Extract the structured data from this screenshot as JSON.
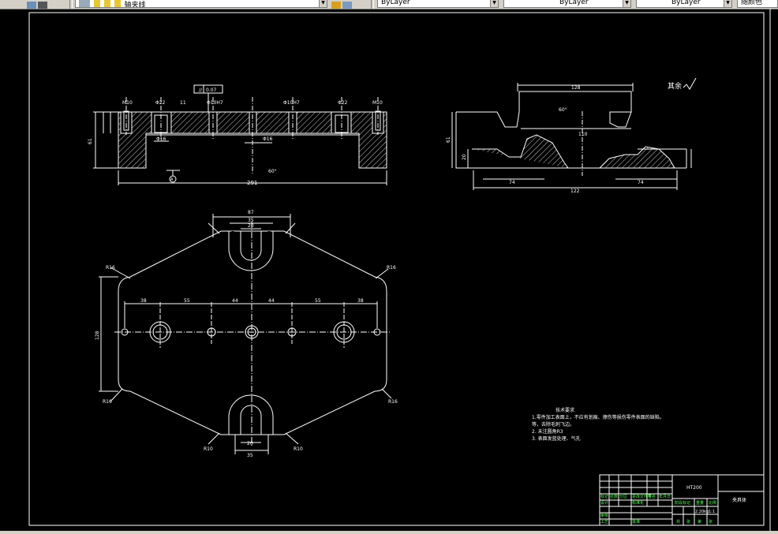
{
  "toolbar": {
    "layer_name": "轴夹线",
    "color_combo": "ByLayer",
    "linetype_combo": "ByLayer",
    "lineweight_combo": "ByLayer",
    "plot_style_combo": "随颜色"
  },
  "drawing": {
    "surface_roughness": "其余",
    "front_view": {
      "total_length": "291",
      "height": "61",
      "flatness_tolerance": "//",
      "flatness_value": "0.07",
      "datum": "A",
      "angle": "60°",
      "labels": [
        "M10",
        "Φ22",
        "11",
        "Φ10H7",
        "Φ10H7",
        "Φ22",
        "M10",
        "Φ16",
        "Φ16"
      ]
    },
    "side_view": {
      "top_width": "128",
      "mid_width": "110",
      "bottom_width": "122",
      "half_width": "74",
      "height": "61",
      "side_height": "20",
      "angle": "60°"
    },
    "plan_view": {
      "top_width": "87",
      "slot_outer": "35",
      "slot_inner": "20",
      "height": "128",
      "bottom_slot_inner": "20",
      "bottom_slot_outer": "35",
      "spacings": [
        "38",
        "55",
        "44",
        "44",
        "55",
        "38"
      ],
      "radii": [
        "R16",
        "R16",
        "R16",
        "R16",
        "R10",
        "R10"
      ]
    }
  },
  "notes": {
    "title": "技术要求",
    "line1": "1.零件加工表面上，不应有划痕、擦伤等损伤零件表面的缺陷。",
    "line1b": "  等，去除毛刺飞边。",
    "line2": "2. 未注圆角R3",
    "line3": "3. 表面发蓝处理、气孔"
  },
  "title_block": {
    "material": "HT200",
    "part_name": "夹具体",
    "scale": "1:1",
    "weight": "2.20kg",
    "cells": [
      "标记",
      "处数",
      "分区",
      "更改文件号",
      "签名",
      "年月日",
      "设计",
      "标准化",
      "阶段标记",
      "重量",
      "比例",
      "审核",
      "工艺",
      "批准",
      "共",
      "张",
      "第",
      "张"
    ]
  }
}
